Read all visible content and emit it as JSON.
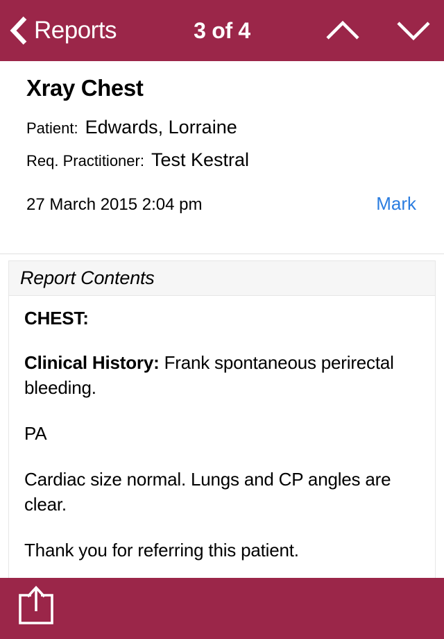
{
  "navbar": {
    "back_label": "Reports",
    "back_icon": "chevron-left-icon",
    "title": "3 of 4",
    "prev_icon": "chevron-up-icon",
    "next_icon": "chevron-down-icon",
    "background_color": "#9B2649",
    "text_color": "#FFFFFF"
  },
  "report": {
    "title": "Xray Chest",
    "patient_label": "Patient:",
    "patient_value": "Edwards, Lorraine",
    "practitioner_label": "Req. Practitioner:",
    "practitioner_value": "Test Kestral",
    "date": "27 March 2015 2:04 pm",
    "mark_label": "Mark",
    "mark_color": "#2B7DE0"
  },
  "contents": {
    "header": "Report Contents",
    "paragraphs": [
      {
        "heading": "CHEST:",
        "text": ""
      },
      {
        "heading": "Clinical History:",
        "text": " Frank spontaneous perirectal bleeding."
      },
      {
        "heading": "",
        "text": "PA"
      },
      {
        "heading": "",
        "text": "Cardiac size normal. Lungs and CP angles are clear."
      },
      {
        "heading": "",
        "text": "Thank you for referring this patient."
      }
    ]
  },
  "toolbar": {
    "share_icon": "share-upload-icon",
    "background_color": "#9B2649"
  }
}
